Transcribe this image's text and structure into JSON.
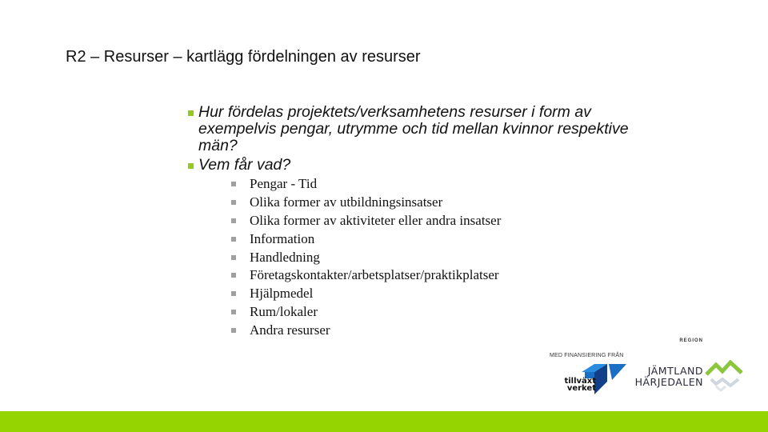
{
  "slide": {
    "title": "R2 – Resurser – kartlägg fördelningen av resurser",
    "questions": [
      "Hur fördelas projektets/verksamhetens resurser i form av exempelvis pengar, utrymme och tid mellan kvinnor respektive män?",
      "Vem får vad?"
    ],
    "sub_items": [
      "Pengar - Tid",
      "Olika former av utbildningsinsatser",
      "Olika former av aktiviteter eller andra insatser",
      "Information",
      "Handledning",
      "Företagskontakter/arbetsplatser/praktikplatser",
      "Hjälpmedel",
      "Rum/lokaler",
      "Andra resurser"
    ]
  },
  "footer": {
    "financing_caption": "MED FINANSIERING FRÅN",
    "tillvaxtverket": {
      "line1": "tillväxt",
      "line2": "verket"
    },
    "region": {
      "prefix": "REGION",
      "line1": "JÄMTLAND",
      "line2": "HÄRJEDALEN"
    }
  },
  "colors": {
    "accent_green": "#96d400",
    "bullet_green": "#96c81e",
    "tva_blue": "#1a6fc4",
    "rjh_green": "#8cc63f"
  }
}
